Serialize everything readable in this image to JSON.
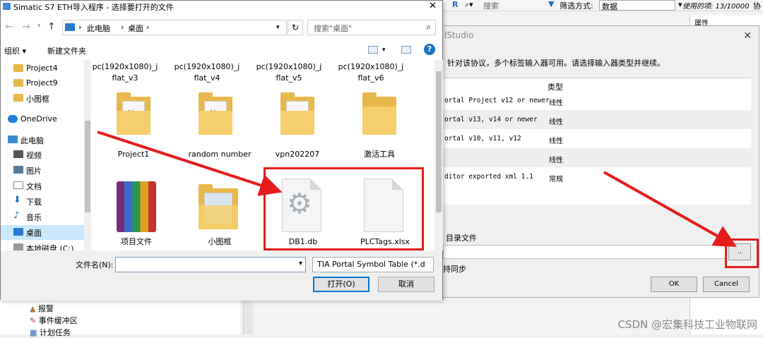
{
  "background_app": {
    "toolbar": {
      "search_placeholder": "搜索",
      "filter_label": "筛选方式:",
      "filter_value": "数据",
      "usage_text": "使用的项: 13/10000",
      "usage_suffix": "协"
    },
    "right_panel_header": "属性",
    "tree_items": [
      "报警",
      "事件缓冲区",
      "计划任务"
    ]
  },
  "import_dialog": {
    "title": "lStudio",
    "hint": "针对该协议，多个标签输入器可用。请选择输入器类型并继续。",
    "column_type": "类型",
    "rows": [
      {
        "name": "ortal Project v12 or newer",
        "type": "线性"
      },
      {
        "name": "ortal v13, v14 or newer",
        "type": "线性"
      },
      {
        "name": "ortal v10, v11, v12",
        "type": "线性"
      },
      {
        "name": "",
        "type": "线性"
      },
      {
        "name": "ditor exported xml 1.1",
        "type": "常规"
      }
    ],
    "dir_label": "目录文件",
    "browse_label": "..",
    "sync_label": "持同步",
    "ok_label": "OK",
    "cancel_label": "Cancel"
  },
  "file_dialog": {
    "title": "Simatic S7 ETH导入程序 - 选择要打开的文件",
    "close": "✕",
    "breadcrumb": [
      "此电脑",
      "桌面"
    ],
    "search_placeholder": "搜索\"桌面\"",
    "organize_label": "组织 ▾",
    "new_folder_label": "新建文件夹",
    "help_label": "?",
    "sidebar": [
      {
        "label": "Project4",
        "icon": "folder-icon"
      },
      {
        "label": "Project9",
        "icon": "folder-icon"
      },
      {
        "label": "小图框",
        "icon": "folder-icon"
      },
      {
        "label": "OneDrive",
        "icon": "cloud-icon"
      },
      {
        "label": "此电脑",
        "icon": "computer-icon"
      },
      {
        "label": "视频",
        "icon": "video-icon"
      },
      {
        "label": "图片",
        "icon": "pictures-icon"
      },
      {
        "label": "文档",
        "icon": "documents-icon"
      },
      {
        "label": "下载",
        "icon": "download-icon"
      },
      {
        "label": "音乐",
        "icon": "music-icon"
      },
      {
        "label": "桌面",
        "icon": "desktop-icon",
        "selected": true
      },
      {
        "label": "本地磁盘 (C:)",
        "icon": "disk-icon"
      }
    ],
    "top_row_labels": [
      "pc(1920x1080)_j flat_v3",
      "pc(1920x1080)_j flat_v4",
      "pc(1920x1080)_j flat_v5",
      "pc(1920x1080)_j flat_v6"
    ],
    "files_row1": [
      {
        "label": "Project1",
        "paper": "Abg"
      },
      {
        "label": "random number",
        "paper": "Abg"
      },
      {
        "label": "vpn202207",
        "paper": "DOCX"
      },
      {
        "label": "激活工具",
        "paper": ""
      }
    ],
    "files_row2": [
      {
        "label": "项目文件"
      },
      {
        "label": "小图框"
      },
      {
        "label": "DB1.db"
      },
      {
        "label": "PLCTags.xlsx"
      }
    ],
    "filename_label": "文件名(N):",
    "filename_value": "",
    "filetype_value": "TIA Portal Symbol Table (*.d",
    "open_label": "打开(O)",
    "cancel_label": "取消"
  },
  "watermark": "CSDN @宏集科技工业物联网",
  "colors": {
    "highlight_red": "#e51c1c",
    "selection_blue": "#cce8ff",
    "folder_yellow": "#e8b84a"
  }
}
